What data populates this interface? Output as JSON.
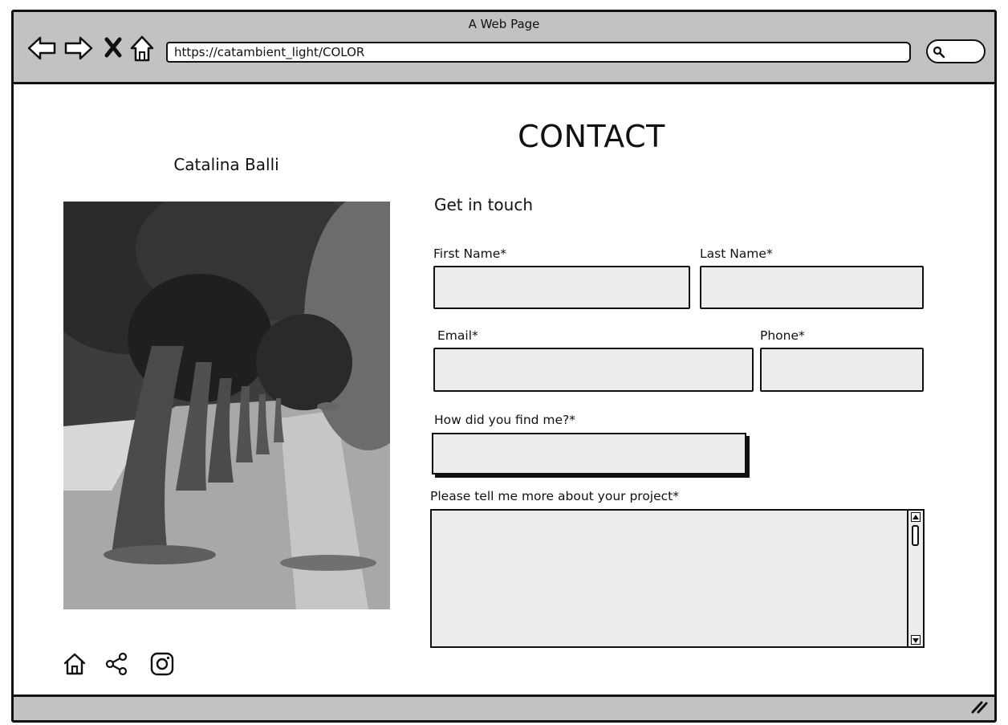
{
  "browser": {
    "title": "A Web Page",
    "url": "https://catambient_light/COLOR"
  },
  "page": {
    "heading": "CONTACT",
    "author_name": "Catalina Balli"
  },
  "form": {
    "subheading": "Get in touch",
    "first_name_label": "First Name*",
    "last_name_label": "Last Name*",
    "email_label": "Email*",
    "phone_label": "Phone*",
    "source_label": "How did you find me?*",
    "project_label": "Please tell me more about your project*",
    "first_name_value": "",
    "last_name_value": "",
    "email_value": "",
    "phone_value": "",
    "source_value": "",
    "project_value": ""
  },
  "icons": {
    "nav": [
      "back-arrow-icon",
      "forward-arrow-icon",
      "stop-icon",
      "home-icon"
    ],
    "footer": [
      "home-icon",
      "share-icon",
      "instagram-icon"
    ]
  }
}
